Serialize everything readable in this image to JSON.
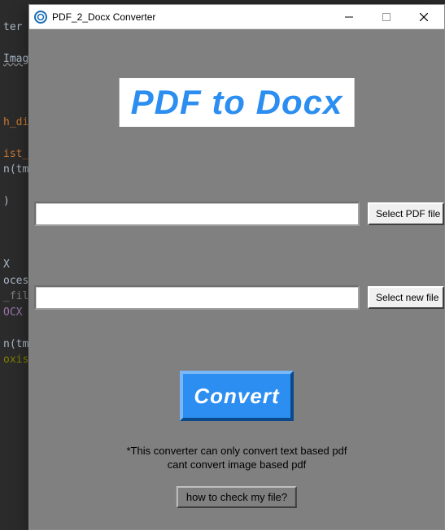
{
  "background_code": {
    "l1": "ter",
    "l2": "Imag",
    "l3": "h_di",
    "l4": "ist_",
    "l5": "n(tm",
    "l6": ")",
    "l7": "X",
    "l8": "oces",
    "l9": "_fil",
    "l10": "OCX",
    "l11": "n(tm",
    "l12": "oxis"
  },
  "window": {
    "title": "PDF_2_Docx Converter"
  },
  "logo_text": "PDF to Docx",
  "input_pdf": {
    "value": "",
    "button_label": "Select PDF file"
  },
  "output_docx": {
    "value": "",
    "button_label": "Select new file"
  },
  "convert_button": "Convert",
  "note_line1": "*This converter can only convert text based pdf",
  "note_line2": "cant convert image based pdf",
  "help_button": "how to check my file?"
}
